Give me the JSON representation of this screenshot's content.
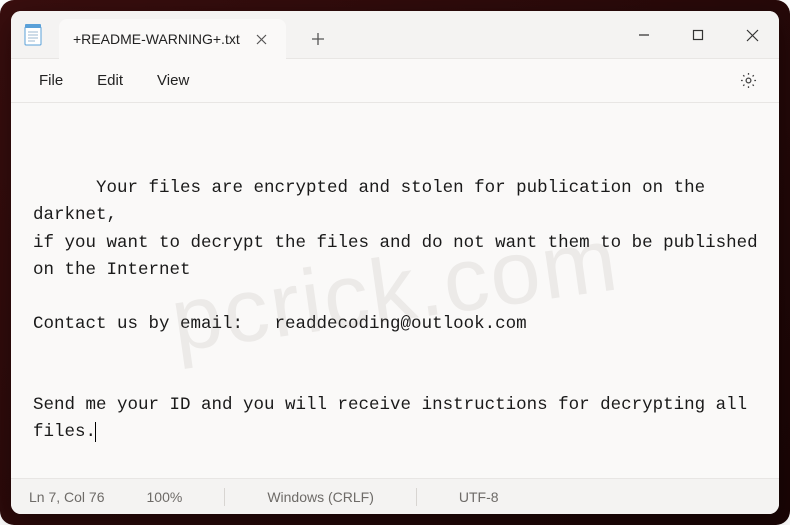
{
  "tab": {
    "title": "+README-WARNING+.txt"
  },
  "menu": {
    "file": "File",
    "edit": "Edit",
    "view": "View"
  },
  "content": "Your files are encrypted and stolen for publication on the darknet,\nif you want to decrypt the files and do not want them to be published on the Internet\n\nContact us by email:   readdecoding@outlook.com\n\n\nSend me your ID and you will receive instructions for decrypting all files.",
  "status": {
    "position": "Ln 7, Col 76",
    "zoom": "100%",
    "line_ending": "Windows (CRLF)",
    "encoding": "UTF-8"
  },
  "watermark": "pcrick.com"
}
